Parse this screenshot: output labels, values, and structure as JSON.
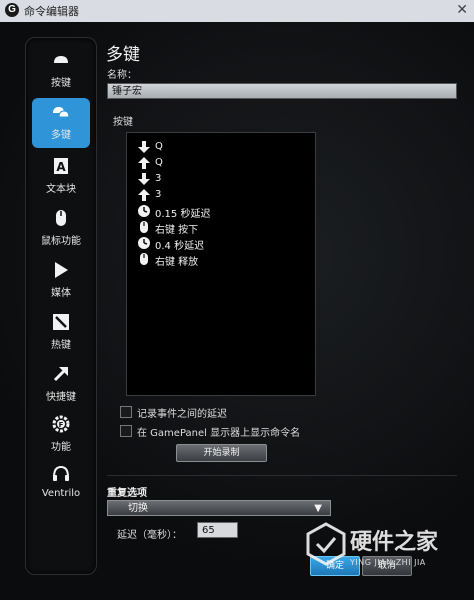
{
  "window": {
    "title": "命令编辑器",
    "logo_letter": "G",
    "close_glyph": "✕"
  },
  "sidebar": {
    "items": [
      {
        "label": "按键",
        "icon": "key-icon",
        "active": false
      },
      {
        "label": "多键",
        "icon": "multi-key-icon",
        "active": true
      },
      {
        "label": "文本块",
        "icon": "text-block-icon",
        "active": false
      },
      {
        "label": "鼠标功能",
        "icon": "mouse-icon",
        "active": false
      },
      {
        "label": "媒体",
        "icon": "play-icon",
        "active": false
      },
      {
        "label": "热键",
        "icon": "hotkey-icon",
        "active": false
      },
      {
        "label": "快捷键",
        "icon": "shortcut-arrow-icon",
        "active": false
      },
      {
        "label": "功能",
        "icon": "function-gear-icon",
        "active": false
      },
      {
        "label": "Ventrilo",
        "icon": "headset-icon",
        "active": false
      }
    ]
  },
  "main": {
    "heading": "多键",
    "name_label": "名称：",
    "name_value": "锤子宏",
    "keys_label": "按键",
    "key_events": [
      {
        "icon": "arrow-down-icon",
        "text": "Q"
      },
      {
        "icon": "arrow-up-icon",
        "text": "Q"
      },
      {
        "icon": "arrow-down-icon",
        "text": "3"
      },
      {
        "icon": "arrow-up-icon",
        "text": "3"
      },
      {
        "icon": "clock-icon",
        "text": "0.15 秒延迟"
      },
      {
        "icon": "mouse-icon",
        "text": "右键 按下"
      },
      {
        "icon": "clock-icon",
        "text": "0.4 秒延迟"
      },
      {
        "icon": "mouse-icon",
        "text": "右键 释放"
      }
    ],
    "checkbox_record_delays": {
      "label": "记录事件之间的延迟",
      "checked": false
    },
    "checkbox_gamepanel": {
      "label": "在 GamePanel 显示器上显示命令名",
      "checked": false
    },
    "record_button": "开始录制",
    "repeat_label": "重复选项",
    "repeat_selected": "切换",
    "delay_label": "延迟（毫秒）：",
    "delay_value": "65",
    "ok_button": "确定",
    "cancel_button": "取消"
  },
  "watermark": {
    "text": "硬件之家",
    "sub": "YING JIAN ZHI JIA"
  },
  "colors": {
    "accent": "#2f95d8",
    "background": "#0b0c0e"
  }
}
